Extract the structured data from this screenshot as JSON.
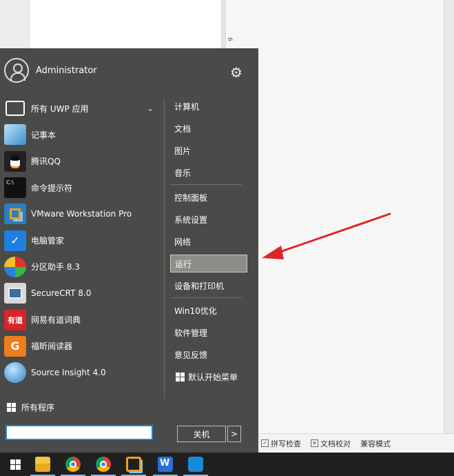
{
  "user": {
    "name": "Administrator"
  },
  "apps": [
    {
      "label": "所有 UWP 应用",
      "icon": "uwp-apps-icon",
      "color": "#4a4a48",
      "glyph": "",
      "has_chevron": true
    },
    {
      "label": "记事本",
      "icon": "notepad-icon",
      "color": "#5aa4d6",
      "glyph": ""
    },
    {
      "label": "腾讯QQ",
      "icon": "qq-penguin-icon",
      "color": "#222222",
      "glyph": ""
    },
    {
      "label": "命令提示符",
      "icon": "cmd-icon",
      "color": "#111111",
      "glyph": "C:\\"
    },
    {
      "label": "VMware Workstation Pro",
      "icon": "vmware-icon",
      "color": "#2a7fc0",
      "glyph": ""
    },
    {
      "label": "电脑管家",
      "icon": "pc-manager-shield-icon",
      "color": "#1f7fe0",
      "glyph": ""
    },
    {
      "label": "分区助手 8.3",
      "icon": "partition-assistant-icon",
      "color": "#e8702a",
      "glyph": ""
    },
    {
      "label": "SecureCRT 8.0",
      "icon": "securecrt-icon",
      "color": "#d8d8d8",
      "glyph": ""
    },
    {
      "label": "网易有道词典",
      "icon": "youdao-dict-icon",
      "color": "#d9242a",
      "glyph": "有道"
    },
    {
      "label": "福昕阅读器",
      "icon": "foxit-reader-icon",
      "color": "#ef7d1a",
      "glyph": "G"
    },
    {
      "label": "Source Insight 4.0",
      "icon": "source-insight-icon",
      "color": "#3d8fd0",
      "glyph": ""
    }
  ],
  "all_programs": "所有程序",
  "search": {
    "value": ""
  },
  "right_items": [
    {
      "label": "计算机",
      "sep_after": false
    },
    {
      "label": "文档",
      "sep_after": false
    },
    {
      "label": "图片",
      "sep_after": false
    },
    {
      "label": "音乐",
      "sep_after": true
    },
    {
      "label": "控制面板",
      "sep_after": false
    },
    {
      "label": "系统设置",
      "sep_after": false
    },
    {
      "label": "网络",
      "sep_after": false
    },
    {
      "label": "运行",
      "sep_after": false,
      "active": true
    },
    {
      "label": "设备和打印机",
      "sep_after": true
    },
    {
      "label": "Win10优化",
      "sep_after": false
    },
    {
      "label": "软件管理",
      "sep_after": false
    },
    {
      "label": "意见反馈",
      "sep_after": false
    },
    {
      "label": "默认开始菜单",
      "sep_after": false,
      "win_icon": true
    }
  ],
  "shutdown": {
    "label": "关机",
    "arrow": ">"
  },
  "doc": {
    "ruler_mark": "6",
    "status": [
      {
        "label": "拼写检查",
        "mark": "✓"
      },
      {
        "label": "文档校对",
        "mark": "✕"
      },
      {
        "label": "兼容模式",
        "mark": ""
      }
    ]
  },
  "taskbar": [
    {
      "icon": "windows-start-icon"
    },
    {
      "icon": "file-explorer-icon"
    },
    {
      "icon": "chrome-icon"
    },
    {
      "icon": "chrome-icon"
    },
    {
      "icon": "vmware-icon"
    },
    {
      "icon": "wps-icon"
    },
    {
      "icon": "phone-icon"
    }
  ],
  "colors": {
    "menu_bg": "#4a4a48",
    "arrow": "#e0252a",
    "taskbar": "#202020"
  }
}
